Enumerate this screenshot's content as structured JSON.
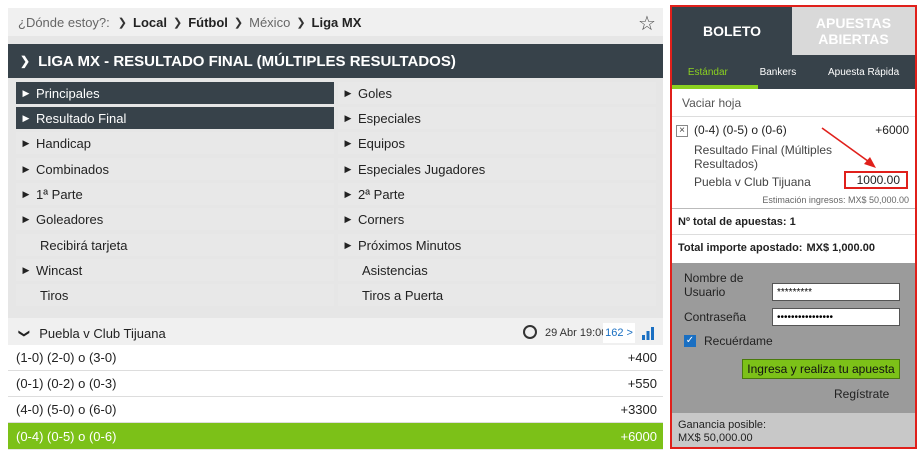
{
  "breadcrumb": {
    "where": "¿Dónde estoy?:",
    "items": [
      "Local",
      "Fútbol",
      "México",
      "Liga MX"
    ]
  },
  "section_title": "LIGA MX - RESULTADO FINAL (MÚLTIPLES RESULTADOS)",
  "markets_left": [
    {
      "label": "Principales",
      "arrow": true,
      "active": true
    },
    {
      "label": "Resultado Final",
      "arrow": true,
      "active": true
    },
    {
      "label": "Handicap",
      "arrow": true,
      "active": false
    },
    {
      "label": "Combinados",
      "arrow": true,
      "active": false
    },
    {
      "label": "1ª Parte",
      "arrow": true,
      "active": false
    },
    {
      "label": "Goleadores",
      "arrow": true,
      "active": false
    },
    {
      "label": "Recibirá tarjeta",
      "arrow": false,
      "active": false
    },
    {
      "label": "Wincast",
      "arrow": true,
      "active": false
    },
    {
      "label": "Tiros",
      "arrow": false,
      "active": false
    }
  ],
  "markets_right": [
    {
      "label": "Goles",
      "arrow": true
    },
    {
      "label": "Especiales",
      "arrow": true
    },
    {
      "label": "Equipos",
      "arrow": true
    },
    {
      "label": "Especiales Jugadores",
      "arrow": true
    },
    {
      "label": "2ª Parte",
      "arrow": true
    },
    {
      "label": "Corners",
      "arrow": true
    },
    {
      "label": "Próximos Minutos",
      "arrow": true
    },
    {
      "label": "Asistencias",
      "arrow": false
    },
    {
      "label": "Tiros a Puerta",
      "arrow": false
    }
  ],
  "event": {
    "title": "Puebla v Club Tijuana",
    "date": "29 Abr 19:00",
    "markets_count": "162 >"
  },
  "odds": [
    {
      "label": "(1-0) (2-0) o (3-0)",
      "price": "+400",
      "selected": false
    },
    {
      "label": "(0-1) (0-2) o (0-3)",
      "price": "+550",
      "selected": false
    },
    {
      "label": "(4-0) (5-0) o (6-0)",
      "price": "+3300",
      "selected": false
    },
    {
      "label": "(0-4) (0-5) o (0-6)",
      "price": "+6000",
      "selected": true
    }
  ],
  "slip": {
    "tab_active": "BOLETO",
    "tab_other": "APUESTAS ABIERTAS",
    "subtabs": [
      "Estándar",
      "Bankers",
      "Apuesta Rápida"
    ],
    "clear": "Vaciar hoja",
    "bet": {
      "selection": "(0-4) (0-5) o (0-6)",
      "odds": "+6000",
      "market": "Resultado Final (Múltiples Resultados)",
      "event": "Puebla v Club Tijuana",
      "stake": "1000.00",
      "estimate": "Estimación ingresos: MX$ 50,000.00"
    },
    "total_bets": "Nº total de apuestas: 1",
    "total_stake_label": "Total importe apostado:",
    "total_stake_value": "MX$ 1,000.00",
    "login": {
      "user_label": "Nombre de Usuario",
      "user_value": "*********",
      "pass_label": "Contraseña",
      "pass_value": "••••••••••••••••",
      "remember": "Recuérdame",
      "submit": "Ingresa y realiza tu apuesta",
      "register": "Regístrate"
    },
    "gain_label": "Ganancia posible:",
    "gain_value": "MX$ 50,000.00"
  },
  "colors": {
    "dark": "#37424a",
    "green": "#7cc118",
    "red_highlight": "#e0201b",
    "blue": "#1a6fc2"
  }
}
